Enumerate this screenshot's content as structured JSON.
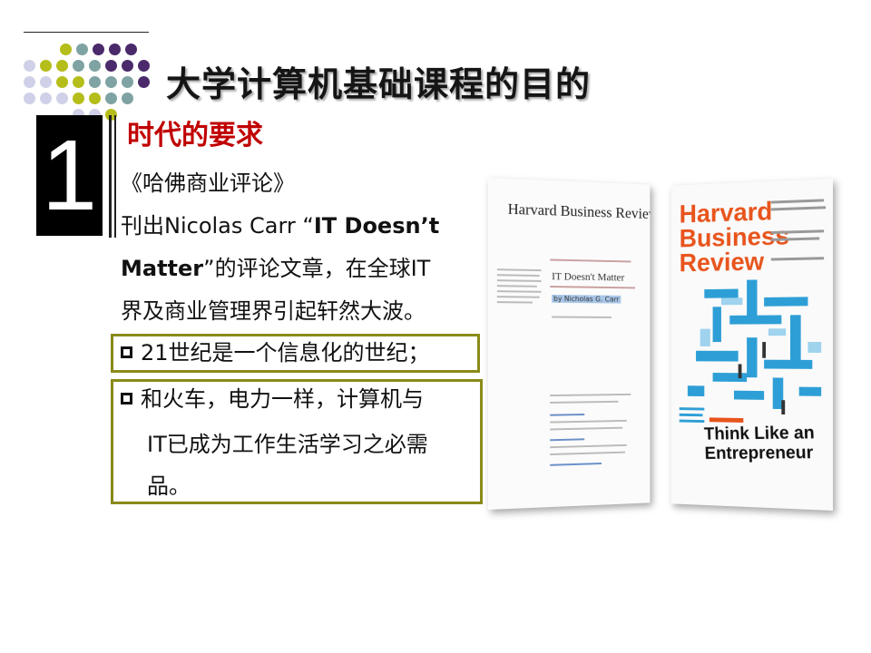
{
  "slide": {
    "title": "大学计算机基础课程的目的",
    "section_number": "1",
    "section_title": "时代的要求",
    "paragraph_lines": [
      "《哈佛商业评论》",
      "刊出Nicolas Carr  “",
      "IT Doesn’t",
      "Matter",
      "”的评论文章，在全球IT",
      "界及商业管理界引起轩然大波。"
    ],
    "bullets": [
      {
        "lines": [
          "21世纪是一个信息化的世纪；"
        ]
      },
      {
        "lines": [
          "和火车，电力一样，计算机与",
          "IT已成为工作生活学习之必需",
          "品。"
        ]
      }
    ]
  },
  "magazines": {
    "left_masthead": "Harvard Business Review",
    "left_article": "IT Doesn't Matter",
    "left_byline": "by Nicholas G. Carr",
    "right_masthead": [
      "Harvard",
      "Business",
      "Review"
    ],
    "right_cover_line": [
      "Think Like an",
      "Entrepreneur"
    ]
  },
  "colors": {
    "accent_red": "#c00000",
    "box_border": "#8a8a1a",
    "dot_lime": "#b5bd1a",
    "dot_teal": "#7fa3a3",
    "dot_purple": "#4b2a6b",
    "dot_lavender": "#d0d0e8",
    "hbr_orange": "#e8541c"
  }
}
